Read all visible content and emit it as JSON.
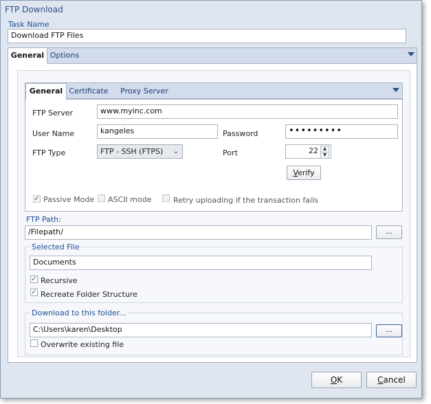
{
  "window": {
    "title": "FTP Download"
  },
  "task": {
    "label": "Task Name",
    "value": "Download FTP Files"
  },
  "outer_tabs": [
    "General",
    "Options"
  ],
  "inner_tabs": [
    "General",
    "Certificate",
    "Proxy Server"
  ],
  "ftp": {
    "server_label": "FTP Server",
    "server_value": "www.myinc.com",
    "user_label": "User Name",
    "user_value": "kangeles",
    "password_label": "Password",
    "password_value": "•••••••••",
    "type_label": "FTP Type",
    "type_value": "FTP - SSH (FTPS)",
    "port_label": "Port",
    "port_value": "22",
    "verify_label": "Verify"
  },
  "options": {
    "passive": {
      "label": "Passive Mode",
      "checked": true
    },
    "ascii": {
      "label": "ASCII mode",
      "checked": false
    },
    "retry": {
      "label": "Retry uploading if the transaction fails",
      "checked": false
    }
  },
  "path": {
    "label": "FTP Path:",
    "value": "/Filepath/",
    "browse_label": "..."
  },
  "selected": {
    "label": "Selected File",
    "value": "Documents",
    "recursive": {
      "label": "Recursive",
      "checked": true
    },
    "recreate": {
      "label": "Recreate Folder Structure",
      "checked": true
    }
  },
  "download": {
    "label": "Download to this folder...",
    "value": "C:\\Users\\karen\\Desktop",
    "browse_label": "...",
    "overwrite": {
      "label": "Overwrite existing file",
      "checked": false
    }
  },
  "buttons": {
    "ok": "OK",
    "cancel": "Cancel"
  }
}
